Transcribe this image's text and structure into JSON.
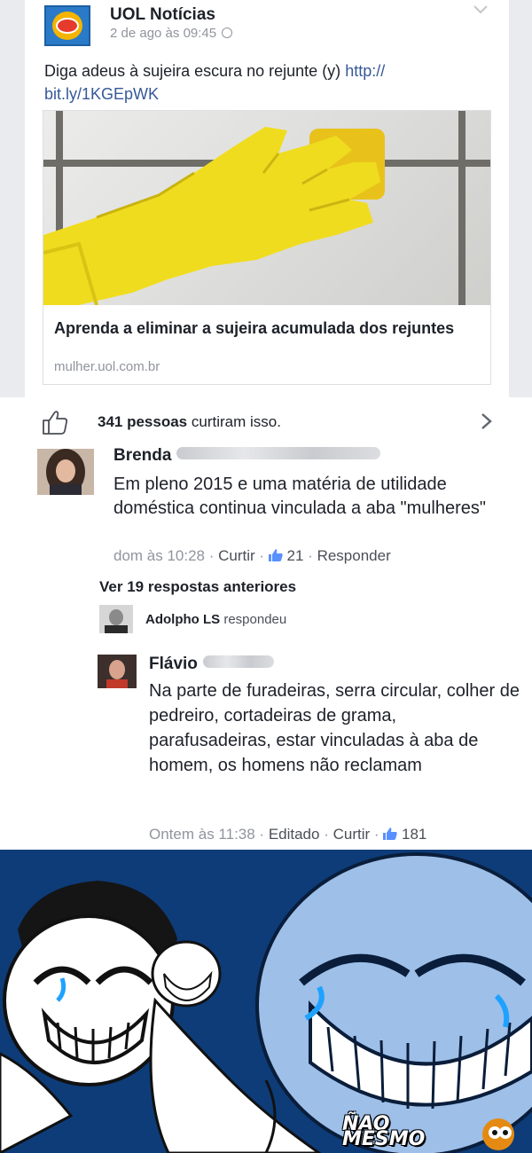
{
  "post": {
    "page_name": "UOL Notícias",
    "timestamp": "2 de ago às 09:45",
    "text": "Diga adeus à sujeira escura no rejunte (y) ",
    "link_text": "http://\nbit.ly/1KGEpWK",
    "link_preview": {
      "title": "Aprenda a eliminar a sujeira acumulada dos rejuntes",
      "domain": "mulher.uol.com.br"
    }
  },
  "likes": {
    "count_label": "341 pessoas",
    "suffix": " curtiram isso."
  },
  "comments": [
    {
      "author": "Brenda",
      "text": "Em pleno 2015 e uma matéria de utilidade doméstica continua vinculada a aba \"mulheres\"",
      "time": "dom às 10:28",
      "like_label": "Curtir",
      "likes": "21",
      "reply_label": "Responder"
    },
    {
      "author": "Flávio",
      "text": "Na parte de furadeiras, serra circular, colher de pedreiro, cortadeiras de grama, parafusadeiras, estar vinculadas à aba de homem, os homens não reclamam",
      "time": "Ontem às 11:38",
      "edited_label": "Editado",
      "like_label": "Curtir",
      "likes": "181"
    }
  ],
  "replies": {
    "view_previous": "Ver 19 respostas anteriores",
    "reply_author": "Adolpho LS",
    "reply_action": "respondeu"
  },
  "meme": {
    "logo_text": "ÑAO\nMESMO"
  },
  "colors": {
    "link": "#365899",
    "meta": "#90949c",
    "meme_background": "#0d3c78"
  }
}
